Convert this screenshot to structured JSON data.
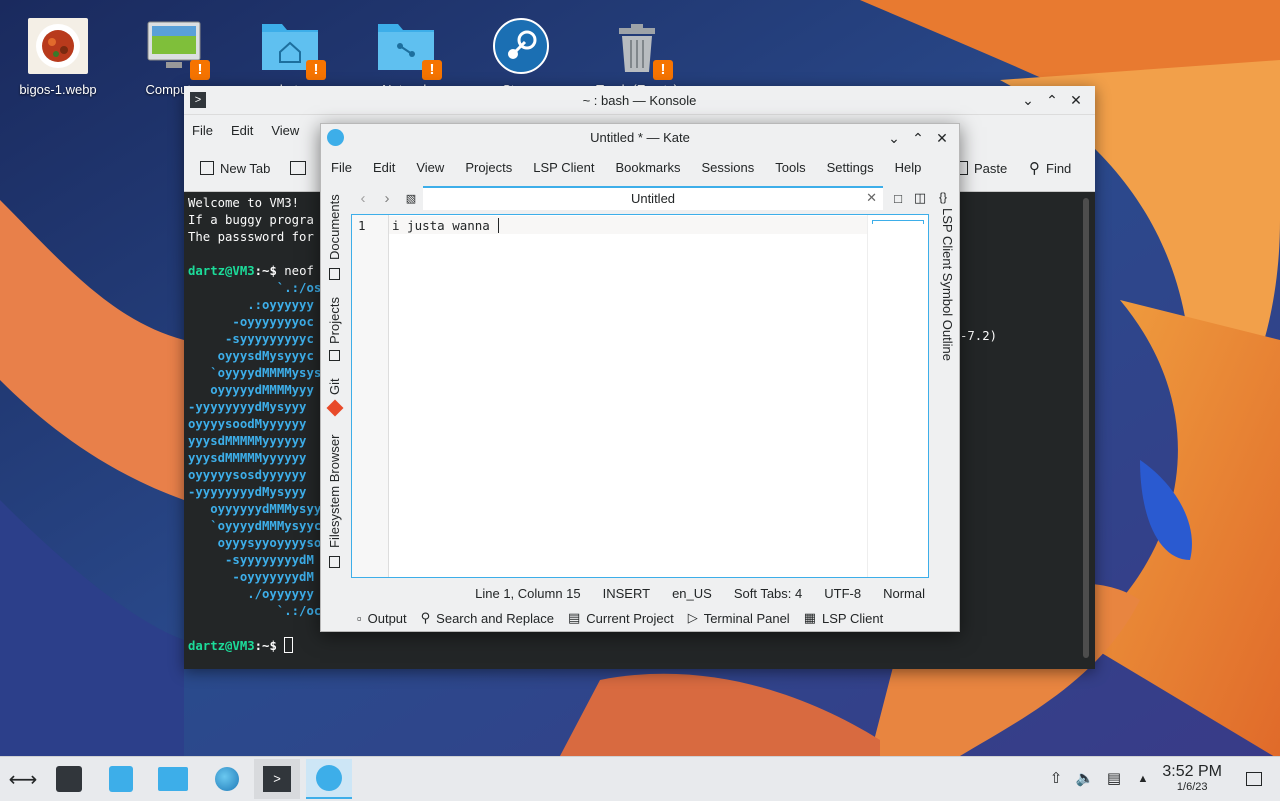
{
  "desktop": {
    "icons": [
      {
        "label": "bigos-1.webp",
        "icon": "image-food-icon"
      },
      {
        "label": "Computer",
        "icon": "computer-icon"
      },
      {
        "label": "dartz",
        "icon": "home-folder-icon"
      },
      {
        "label": "Network",
        "icon": "network-folder-icon"
      },
      {
        "label": "Steam",
        "icon": "steam-icon"
      },
      {
        "label": "Trash (Empty)",
        "icon": "trash-icon"
      }
    ]
  },
  "konsole": {
    "title": "~ : bash — Konsole",
    "menu": [
      "File",
      "Edit",
      "View"
    ],
    "toolbar": {
      "new_tab": "New Tab",
      "paste": "Paste",
      "find": "Find"
    },
    "terminal": {
      "welcome": "Welcome to VM3!",
      "line2": "If a buggy progra",
      "line3": "The passsword for",
      "prompt_user": "dartz@VM3",
      "prompt_path": ":~$ ",
      "cmd": "neof",
      "art": [
        "            `.:/os",
        "        .:oyyyyyy",
        "      -oyyyyyyyoc",
        "     -syyyyyyyyyc",
        "    oyyysdMysyyyc",
        "   `oyyyydMMMMysys",
        "   oyyyyydMMMMyyy",
        "-yyyyyyyydMysyyy",
        "oyyyysoodMyyyyyy",
        "yyysdMMMMMyyyyyy",
        "yyysdMMMMMyyyyyy",
        "oyyyyysosdyyyyyy",
        "-yyyyyyyydMysyyy",
        "   oyyyyyydMMMysyy",
        "   `oyyyydMMMysyyc",
        "    oyyysyyoyyyyso",
        "     -syyyyyyyydM",
        "      -oyyyyyyydM",
        "        ./oyyyyyy",
        "            `.:/oc"
      ],
      "sysinfo_fragment": "-7.2)",
      "final_prompt_user": "dartz@VM3",
      "final_prompt_path": ":~$ "
    }
  },
  "kate": {
    "title": "Untitled * — Kate",
    "menu": [
      "File",
      "Edit",
      "View",
      "Projects",
      "LSP Client",
      "Bookmarks",
      "Sessions",
      "Tools",
      "Settings",
      "Help"
    ],
    "left_tabs": [
      "Documents",
      "Projects",
      "Git",
      "Filesystem Browser"
    ],
    "right_tab": "LSP Client Symbol Outline",
    "tab_title": "Untitled",
    "line_number": "1",
    "content": "i justa wanna ",
    "status": {
      "position": "Line 1, Column 15",
      "mode": "INSERT",
      "lang": "en_US",
      "indent": "Soft Tabs: 4",
      "encoding": "UTF-8",
      "input_mode": "Normal"
    },
    "bottom_panels": [
      "Output",
      "Search and Replace",
      "Current Project",
      "Terminal Panel",
      "LSP Client"
    ]
  },
  "taskbar": {
    "clock_time": "3:52 PM",
    "clock_date": "1/6/23"
  },
  "colors": {
    "accent": "#3daee9",
    "warning": "#f67400",
    "terminal_bg": "#232627",
    "prompt_green": "#1cdc9a"
  }
}
